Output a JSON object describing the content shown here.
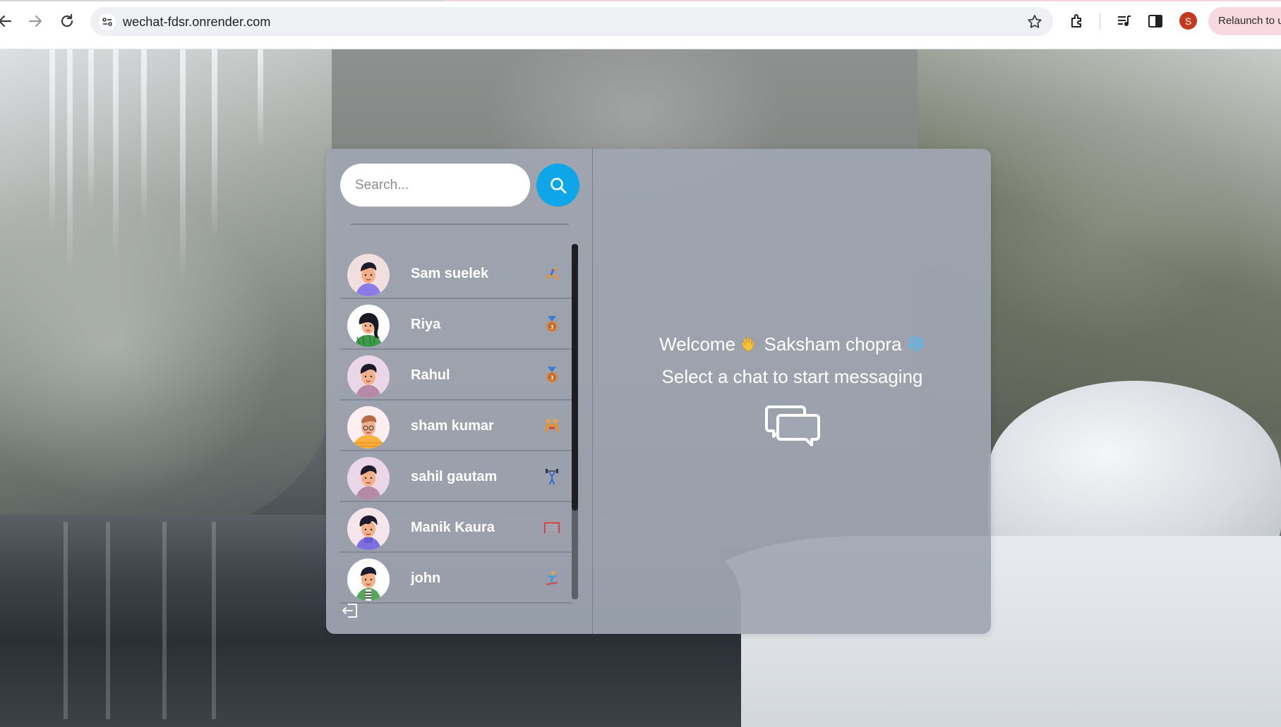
{
  "browser": {
    "url": "wechat-fdsr.onrender.com",
    "profile_initial": "S",
    "relaunch_label": "Relaunch to u"
  },
  "search": {
    "placeholder": "Search..."
  },
  "users": [
    {
      "name": "Sam suelek",
      "emoji_icon": "gymnast-icon"
    },
    {
      "name": "Riya",
      "emoji_icon": "bronze-medal-icon"
    },
    {
      "name": "Rahul",
      "emoji_icon": "bronze-medal-icon"
    },
    {
      "name": "sham kumar",
      "emoji_icon": "wrestlers-icon"
    },
    {
      "name": "sahil gautam",
      "emoji_icon": "weightlifter-icon"
    },
    {
      "name": "Manik Kaura",
      "emoji_icon": "goal-net-icon"
    },
    {
      "name": "john",
      "emoji_icon": "skier-icon"
    }
  ],
  "main": {
    "welcome_prefix": "Welcome",
    "user_name": "Saksham chopra",
    "subtitle": "Select a chat to start messaging"
  },
  "colors": {
    "accent": "#0ea5e9",
    "card_bg": "#a0a6b2",
    "profile": "#c4391d"
  }
}
